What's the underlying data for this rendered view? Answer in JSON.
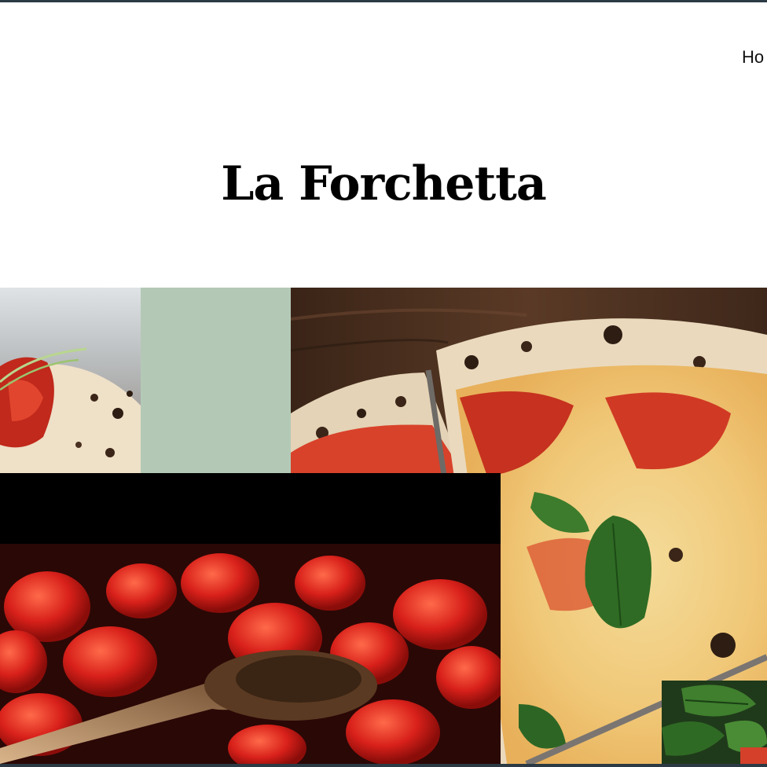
{
  "nav": {
    "home_label": "Ho"
  },
  "site": {
    "title": "La Forchetta"
  },
  "colors": {
    "border": "#2b3a44",
    "sage_block": "#b3c9b6",
    "background": "#ffffff"
  },
  "images": {
    "pizza_closeup": "pizza-slice-photo",
    "sage_block": "color-block",
    "pizza_main": "margherita-pizza-photo",
    "tomatoes": "cherry-tomatoes-spoon-photo",
    "basil": "basil-leaves-photo"
  }
}
